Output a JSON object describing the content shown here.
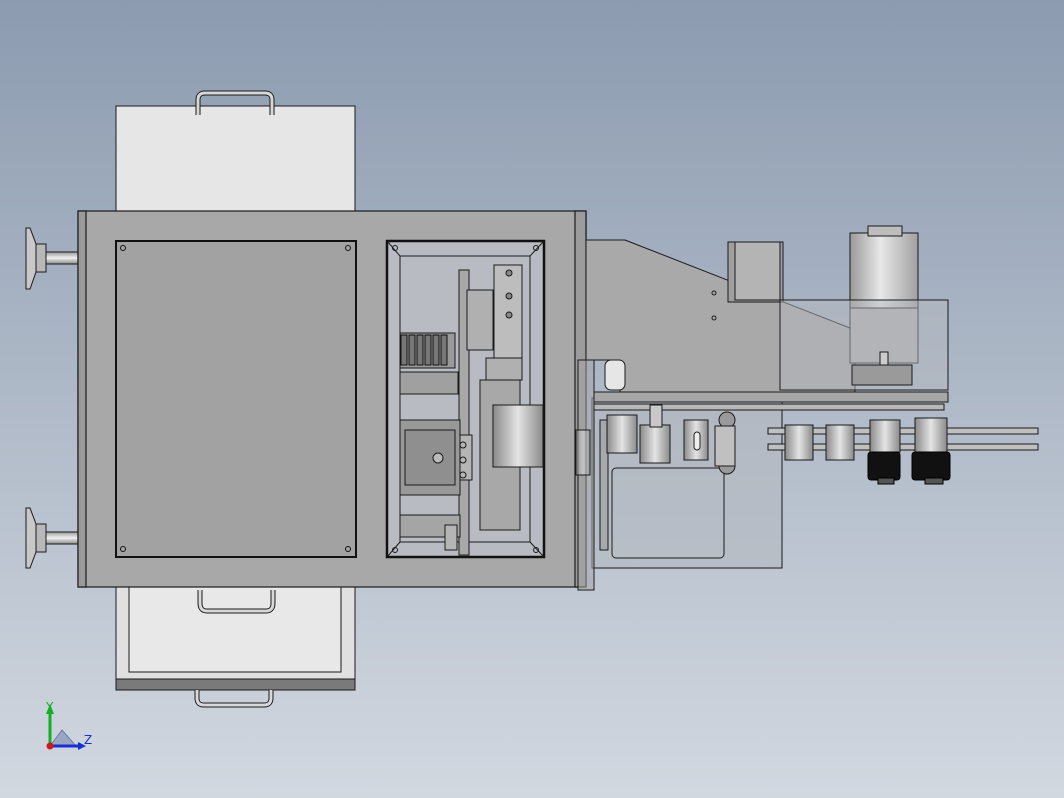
{
  "viewport": {
    "background_top": "#8c9bb0",
    "background_bottom": "#d2d8e0",
    "part_colors": {
      "panel": "#a6a6a6",
      "panel_dark": "#8e8e8e",
      "edge": "#1a1a1a",
      "transparent_fill": "#b4b8be",
      "motor_black": "#111111"
    }
  },
  "triad": {
    "y_label": "Y",
    "z_label": "Z",
    "x_color": "#d01818",
    "y_color": "#10b020",
    "z_color": "#1830d0"
  }
}
